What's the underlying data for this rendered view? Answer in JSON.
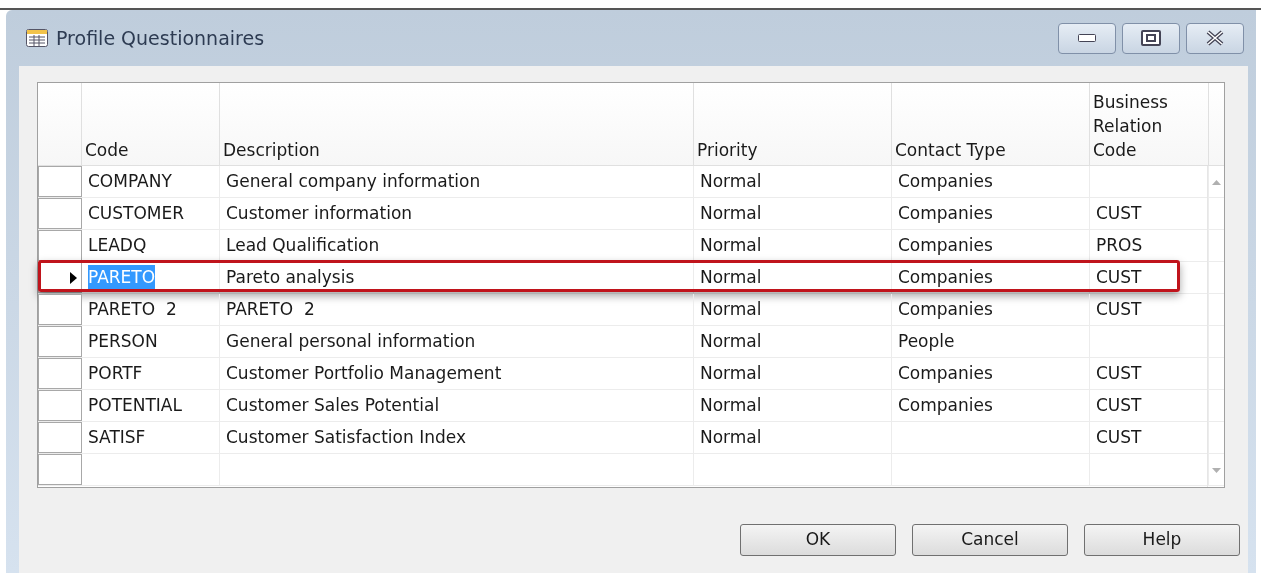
{
  "window": {
    "title": "Profile Questionnaires"
  },
  "table": {
    "columns": [
      "Code",
      "Description",
      "Priority",
      "Contact Type",
      "Business Relation Code"
    ],
    "rows": [
      {
        "cells": [
          "COMPANY",
          "General company information",
          "Normal",
          "Companies",
          ""
        ],
        "selected": false
      },
      {
        "cells": [
          "CUSTOMER",
          "Customer information",
          "Normal",
          "Companies",
          "CUST"
        ],
        "selected": false
      },
      {
        "cells": [
          "LEADQ",
          "Lead Qualification",
          "Normal",
          "Companies",
          "PROS"
        ],
        "selected": false
      },
      {
        "cells": [
          "PARETO",
          "Pareto analysis",
          "Normal",
          "Companies",
          "CUST"
        ],
        "selected": true
      },
      {
        "cells": [
          "PARETO  2",
          "PARETO  2",
          "Normal",
          "Companies",
          "CUST"
        ],
        "selected": false
      },
      {
        "cells": [
          "PERSON",
          "General personal information",
          "Normal",
          "People",
          ""
        ],
        "selected": false
      },
      {
        "cells": [
          "PORTF",
          "Customer Portfolio Management",
          "Normal",
          "Companies",
          "CUST"
        ],
        "selected": false
      },
      {
        "cells": [
          "POTENTIAL",
          "Customer Sales Potential",
          "Normal",
          "Companies",
          "CUST"
        ],
        "selected": false
      },
      {
        "cells": [
          "SATISF",
          "Customer Satisfaction Index",
          "Normal",
          "",
          "CUST"
        ],
        "selected": false
      }
    ]
  },
  "buttons": [
    "OK",
    "Cancel",
    "Help"
  ]
}
